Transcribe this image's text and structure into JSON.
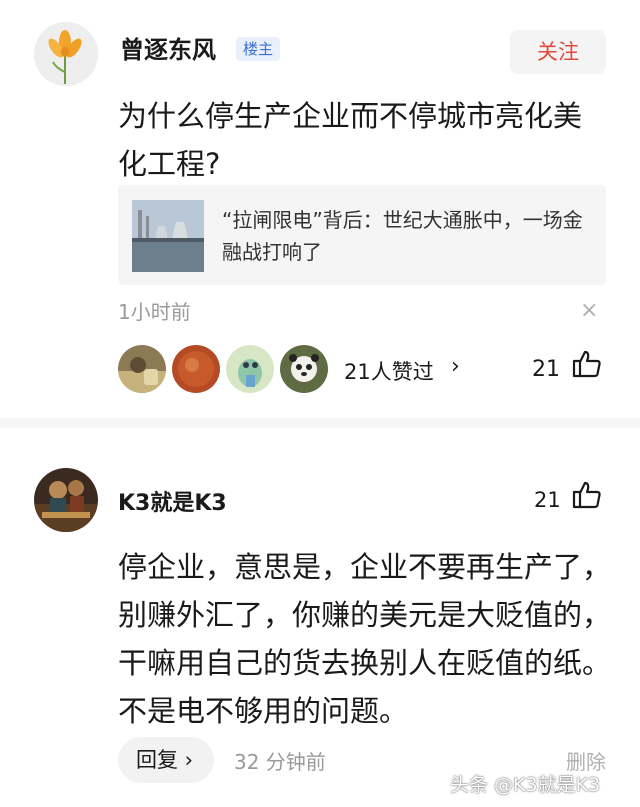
{
  "comment1": {
    "author": "曾逐东风",
    "badge": "楼主",
    "follow_label": "关注",
    "question": "为什么停生产企业而不停城市亮化美化工程?",
    "link_card": {
      "text": "“拉闸限电”背后：世纪大通胀中，一场金融战打响了"
    },
    "time": "1小时前",
    "close_symbol": "×",
    "likers_text": "21人赞过",
    "likers_chevron": "›",
    "like_count": "21"
  },
  "comment2": {
    "author": "K3就是K3",
    "like_count": "21",
    "body": "停企业，意思是，企业不要再生产了，别赚外汇了，你赚的美元是大贬值的，干嘛用自己的货去换别人在贬值的纸。不是电不够用的问题。",
    "reply_label": "回复 ›",
    "time": "32 分钟前",
    "delete_label": "删除"
  },
  "watermark": "头条 @K3就是K3",
  "icons": {
    "avatar1": "flower-avatar",
    "avatar2": "painting-avatar",
    "thumb": "thumbs-up-icon",
    "close": "close-icon"
  },
  "colors": {
    "follow": "#e04a3a",
    "badge": "#3a6fd8",
    "secondary_text": "#9a9a9a"
  }
}
